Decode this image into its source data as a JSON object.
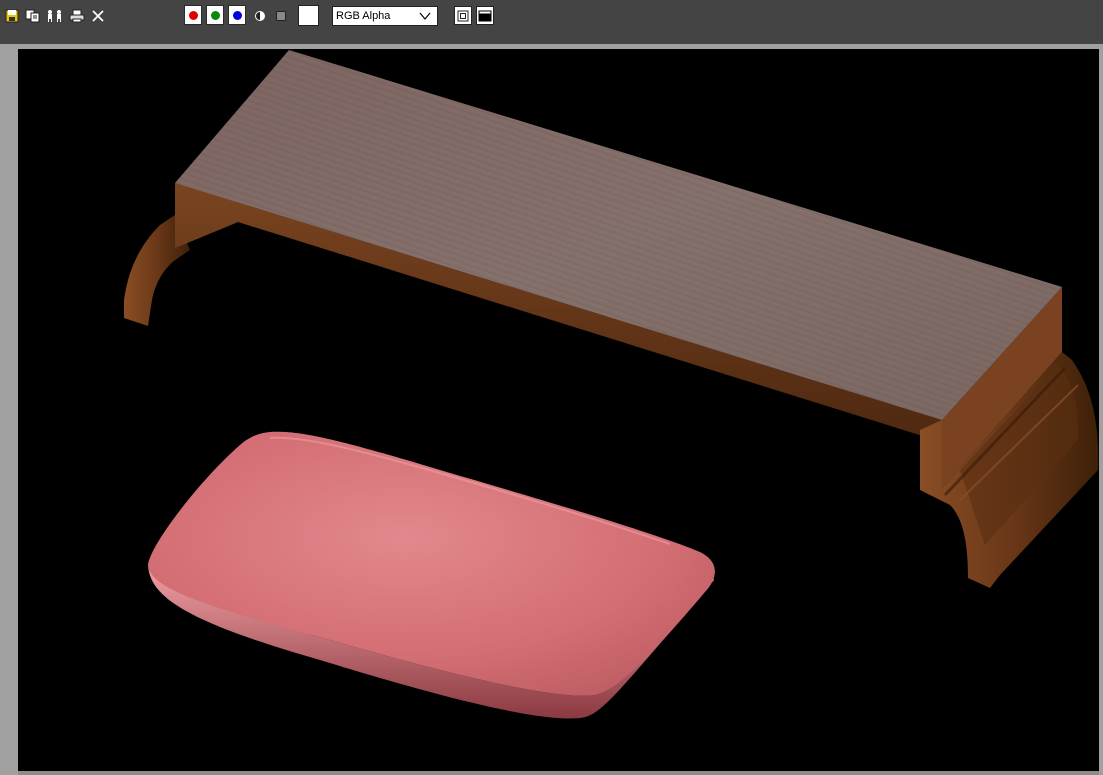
{
  "toolbar": {
    "icons": [
      "save-icon",
      "copy-icon",
      "clone-icon",
      "print-icon",
      "clear-icon"
    ],
    "channels": [
      {
        "name": "red-channel",
        "color": "#e00000"
      },
      {
        "name": "green-channel",
        "color": "#0a8a0a"
      },
      {
        "name": "blue-channel",
        "color": "#0000e0"
      }
    ],
    "swatch_color": "#ffffff",
    "channel_display": {
      "selected": "RGB Alpha"
    }
  },
  "render": {
    "scene_objects": [
      "wooden-table",
      "pink-cushion"
    ],
    "background_color": "#000000",
    "wood_color": "#6b3a1e",
    "tabletop_color": "#7a6560",
    "cushion_color": "#d97378"
  }
}
